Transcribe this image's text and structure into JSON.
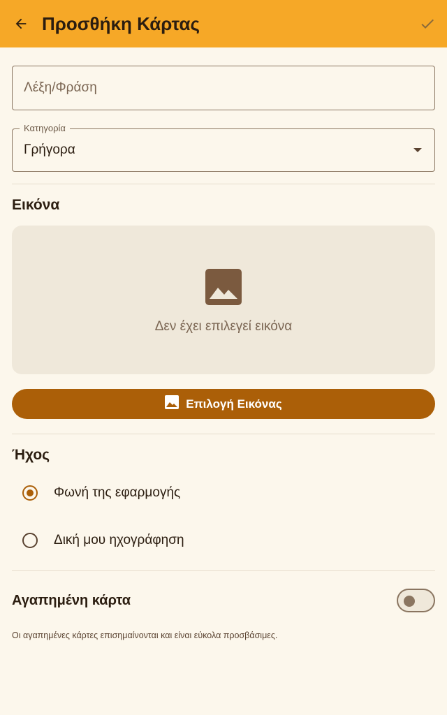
{
  "appbar": {
    "back_icon": "arrow-back-icon",
    "title": "Προσθήκη Κάρτας",
    "confirm_icon": "check-icon"
  },
  "colors": {
    "appbar": "#f6a827",
    "background": "#fcf7ec",
    "accent": "#ab5f08",
    "image_placeholder_bg": "#efe8da"
  },
  "form": {
    "phrase": {
      "placeholder": "Λέξη/Φράση",
      "value": ""
    },
    "category": {
      "label": "Κατηγορία",
      "value": "Γρήγορα"
    }
  },
  "image_section": {
    "title": "Εικόνα",
    "placeholder_icon": "image-icon",
    "placeholder_text": "Δεν έχει επιλεγεί εικόνα",
    "pick_button": {
      "icon": "image-icon",
      "label": "Επιλογή Εικόνας"
    }
  },
  "sound_section": {
    "title": "Ήχος",
    "options": [
      {
        "label": "Φωνή της εφαρμογής",
        "selected": true
      },
      {
        "label": "Δική μου ηχογράφηση",
        "selected": false
      }
    ]
  },
  "favorite": {
    "label": "Αγαπημένη κάρτα",
    "enabled": false,
    "note": "Οι αγαπημένες κάρτες επισημαίνονται και είναι εύκολα προσβάσιμες."
  }
}
